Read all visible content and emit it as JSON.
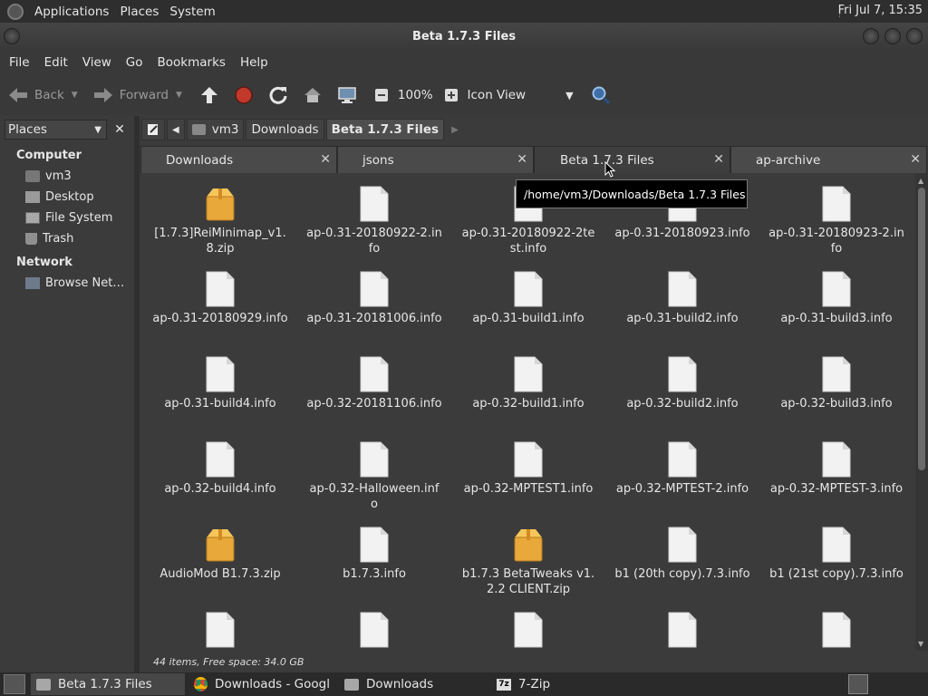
{
  "topbar": {
    "menus": [
      "Applications",
      "Places",
      "System"
    ],
    "clock": "Fri Jul  7, 15:35"
  },
  "window": {
    "title": "Beta 1.7.3 Files"
  },
  "menubar": [
    "File",
    "Edit",
    "View",
    "Go",
    "Bookmarks",
    "Help"
  ],
  "toolbar": {
    "back": "Back",
    "forward": "Forward",
    "zoom": "100%",
    "view_mode": "Icon View"
  },
  "sidebar": {
    "selector": "Places",
    "computer_heading": "Computer",
    "computer_items": [
      "vm3",
      "Desktop",
      "File System",
      "Trash"
    ],
    "network_heading": "Network",
    "network_items": [
      "Browse Net…"
    ]
  },
  "pathbar": [
    "vm3",
    "Downloads",
    "Beta 1.7.3 Files"
  ],
  "tabs": [
    "Downloads",
    "jsons",
    "Beta 1.7.3 Files",
    "ap-archive"
  ],
  "tooltip": "/home/vm3/Downloads/Beta 1.7.3 Files",
  "files": [
    {
      "name": "[1.7.3]ReiMinimap_v1.8.zip",
      "type": "archive"
    },
    {
      "name": "ap-0.31-20180922-2.info",
      "type": "file"
    },
    {
      "name": "ap-0.31-20180922-2test.info",
      "type": "file"
    },
    {
      "name": "ap-0.31-20180923.info",
      "type": "file"
    },
    {
      "name": "ap-0.31-20180923-2.info",
      "type": "file"
    },
    {
      "name": "ap-0.31-20180929.info",
      "type": "file"
    },
    {
      "name": "ap-0.31-20181006.info",
      "type": "file"
    },
    {
      "name": "ap-0.31-build1.info",
      "type": "file"
    },
    {
      "name": "ap-0.31-build2.info",
      "type": "file"
    },
    {
      "name": "ap-0.31-build3.info",
      "type": "file"
    },
    {
      "name": "ap-0.31-build4.info",
      "type": "file"
    },
    {
      "name": "ap-0.32-20181106.info",
      "type": "file"
    },
    {
      "name": "ap-0.32-build1.info",
      "type": "file"
    },
    {
      "name": "ap-0.32-build2.info",
      "type": "file"
    },
    {
      "name": "ap-0.32-build3.info",
      "type": "file"
    },
    {
      "name": "ap-0.32-build4.info",
      "type": "file"
    },
    {
      "name": "ap-0.32-Halloween.info",
      "type": "file"
    },
    {
      "name": "ap-0.32-MPTEST1.info",
      "type": "file"
    },
    {
      "name": "ap-0.32-MPTEST-2.info",
      "type": "file"
    },
    {
      "name": "ap-0.32-MPTEST-3.info",
      "type": "file"
    },
    {
      "name": "AudioMod B1.7.3.zip",
      "type": "archive"
    },
    {
      "name": "b1.7.3.info",
      "type": "file"
    },
    {
      "name": "b1.7.3 BetaTweaks v1.2.2 CLIENT.zip",
      "type": "archive"
    },
    {
      "name": "b1 (20th copy).7.3.info",
      "type": "file"
    },
    {
      "name": "b1 (21st copy).7.3.info",
      "type": "file"
    },
    {
      "name": "",
      "type": "file"
    },
    {
      "name": "",
      "type": "file"
    },
    {
      "name": "",
      "type": "file"
    },
    {
      "name": "",
      "type": "file"
    },
    {
      "name": "",
      "type": "file"
    }
  ],
  "status": "44 items, Free space: 34.0 GB",
  "taskbar": [
    {
      "label": "Beta 1.7.3 Files",
      "icon": "folder-icon",
      "active": true
    },
    {
      "label": "Downloads - Googl…",
      "icon": "chrome-icon",
      "active": false
    },
    {
      "label": "Downloads",
      "icon": "folder-icon",
      "active": false
    },
    {
      "label": "7-Zip",
      "icon": "sevenzip-icon",
      "active": false
    }
  ]
}
